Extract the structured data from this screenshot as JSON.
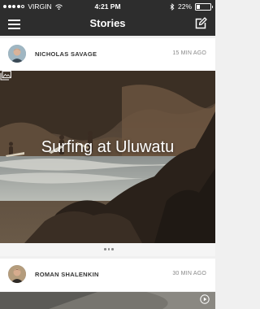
{
  "status_bar": {
    "carrier": "VIRGIN",
    "time": "4:21 PM",
    "battery_percent": "22%",
    "battery_level": 0.22,
    "signal_bars": 4
  },
  "nav": {
    "title": "Stories",
    "menu_icon": "hamburger-icon",
    "compose_icon": "compose-icon"
  },
  "stories": [
    {
      "author": "NICHOLAS SAVAGE",
      "time_ago": "15 MIN AGO",
      "title": "Surfing at Uluwatu",
      "media_icon": "gallery-icon"
    },
    {
      "author": "ROMAN SHALENKIN",
      "time_ago": "30 MIN AGO",
      "media_icon": "play-icon"
    }
  ],
  "colors": {
    "nav_background": "#2d2d2d",
    "page_background": "#f0f0f0",
    "card_background": "#ffffff",
    "meta_text": "#888888"
  }
}
